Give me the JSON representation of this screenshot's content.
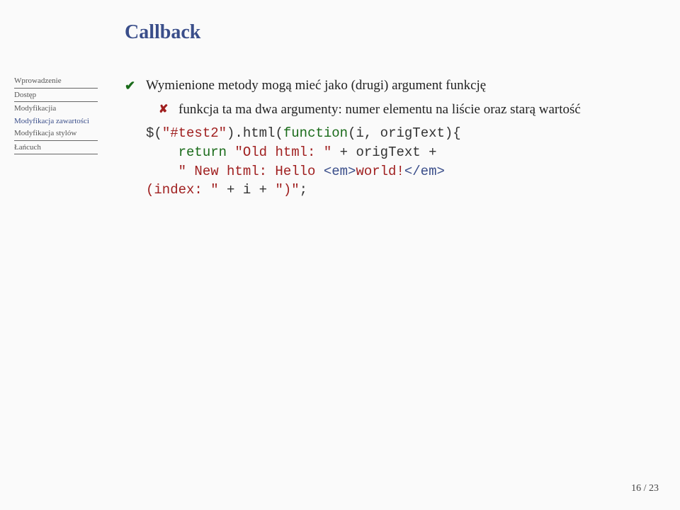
{
  "title": "Callback",
  "sidebar": {
    "items": [
      {
        "label": "Wprowadzenie",
        "active": false,
        "underline": true
      },
      {
        "label": "Dostęp",
        "active": false,
        "underline": true
      },
      {
        "label": "Modyfikacjia",
        "active": false,
        "underline": false
      },
      {
        "label": "Modyfikacja zawartości",
        "active": true,
        "underline": false
      },
      {
        "label": "Modyfikacja stylów",
        "active": false,
        "underline": true
      },
      {
        "label": "Łańcuch",
        "active": false,
        "underline": true
      }
    ]
  },
  "content": {
    "bullet1": "Wymienione metody mogą mieć jako (drugi) argument funkcję",
    "sub1": "funkcja ta ma dwa argumenty: numer elementu na liście oraz starą wartość",
    "code": {
      "l1a": "$(",
      "l1b": "\"#test2\"",
      "l1c": ").html(",
      "l1d": "function",
      "l1e": "(i, origText){",
      "l2a": "    ",
      "l2b": "return",
      "l2c": " ",
      "l2d": "\"Old html: \"",
      "l2e": " + origText +",
      "l3a": "    ",
      "l3b": "\" New html: Hello ",
      "l3c": "<em>",
      "l3d": "world!",
      "l3e": "</em>",
      "l4a": "(index: \"",
      "l4b": " + i + ",
      "l4c": "\")\"",
      "l4d": ";"
    }
  },
  "page": {
    "current": "16",
    "sep": " / ",
    "total": "23"
  }
}
